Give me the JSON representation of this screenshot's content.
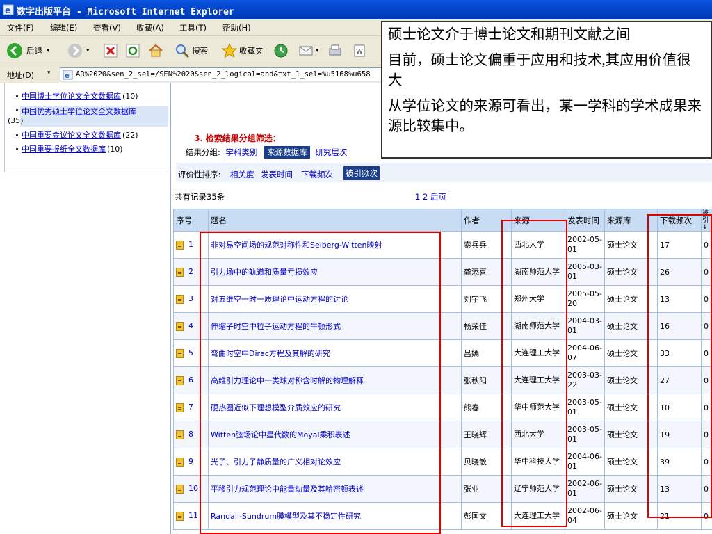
{
  "window": {
    "title": "数字出版平台 - Microsoft Internet Explorer"
  },
  "menu": [
    "文件(F)",
    "编辑(E)",
    "查看(V)",
    "收藏(A)",
    "工具(T)",
    "帮助(H)"
  ],
  "toolbar": {
    "back_label": "后退",
    "search_label": "搜索",
    "favorites_label": "收藏夹"
  },
  "address": {
    "label": "地址(D)",
    "url": "AR%2020&sen_2_sel=/SEN%2020&sen_2_logical=and&txt_1_sel=%u5168%u658"
  },
  "left_nav": {
    "items": [
      {
        "label": "中国博士学位论文全文数据库",
        "count": "(10)"
      },
      {
        "label": "中国优秀硕士学位论文全文数据库",
        "count": "(35)"
      },
      {
        "label": "中国重要会议论文全文数据库",
        "count": "(22)"
      },
      {
        "label": "中国重要报纸全文数据库",
        "count": "(10)"
      }
    ]
  },
  "filter": {
    "step_title": "3. 检索结果分组筛选：",
    "group_label": "结果分组:",
    "group_options": [
      "学科类别",
      "来源数据库",
      "研究层次"
    ],
    "group_selected": "来源数据库"
  },
  "sort": {
    "label": "评价性排序:",
    "options": [
      "相关度",
      "发表时间",
      "下载频次",
      "被引频次"
    ],
    "selected": "被引频次"
  },
  "results": {
    "count_text": "共有记录35条",
    "pager": "1 2 后页",
    "headers": [
      "序号",
      "题名",
      "作者",
      "来源",
      "发表时间",
      "来源库",
      "下载频次",
      "被引↓"
    ],
    "rows": [
      {
        "no": "1",
        "title": "非对易空间场的规范对称性和Seiberg-Witten映射",
        "author": "索兵兵",
        "source": "西北大学",
        "date": "2002-05-01",
        "db": "硕士论文",
        "downloads": "17",
        "cited": "0"
      },
      {
        "no": "2",
        "title": "引力场中的轨道和质量亏损效应",
        "author": "龚添喜",
        "source": "湖南师范大学",
        "date": "2005-03-01",
        "db": "硕士论文",
        "downloads": "26",
        "cited": "0"
      },
      {
        "no": "3",
        "title": "对五维空一时一质理论中运动方程的讨论",
        "author": "刘宇飞",
        "source": "郑州大学",
        "date": "2005-05-20",
        "db": "硕士论文",
        "downloads": "13",
        "cited": "0"
      },
      {
        "no": "4",
        "title": "伸缩子时空中粒子运动方程的牛顿形式",
        "author": "杨荣佳",
        "source": "湖南师范大学",
        "date": "2004-03-01",
        "db": "硕士论文",
        "downloads": "16",
        "cited": "0"
      },
      {
        "no": "5",
        "title": "弯曲时空中Dirac方程及其解的研究",
        "author": "吕嫣",
        "source": "大连理工大学",
        "date": "2004-06-07",
        "db": "硕士论文",
        "downloads": "33",
        "cited": "0"
      },
      {
        "no": "6",
        "title": "高维引力理论中一类球对称含时解的物理解释",
        "author": "张秋阳",
        "source": "大连理工大学",
        "date": "2003-03-22",
        "db": "硕士论文",
        "downloads": "27",
        "cited": "0"
      },
      {
        "no": "7",
        "title": "硬热圈近似下理想模型介质效应的研究",
        "author": "熊春",
        "source": "华中师范大学",
        "date": "2003-05-01",
        "db": "硕士论文",
        "downloads": "10",
        "cited": "0"
      },
      {
        "no": "8",
        "title": "Witten弦场论中星代数的Moyal乘积表述",
        "author": "王晓辉",
        "source": "西北大学",
        "date": "2003-05-01",
        "db": "硕士论文",
        "downloads": "19",
        "cited": "0"
      },
      {
        "no": "9",
        "title": "光子、引力子静质量的广义相对论效应",
        "author": "贝晓敏",
        "source": "华中科技大学",
        "date": "2004-06-01",
        "db": "硕士论文",
        "downloads": "39",
        "cited": "0"
      },
      {
        "no": "10",
        "title": "平移引力规范理论中能量动量及其哈密顿表述",
        "author": "张业",
        "source": "辽宁师范大学",
        "date": "2002-06-01",
        "db": "硕士论文",
        "downloads": "13",
        "cited": "0"
      },
      {
        "no": "11",
        "title": "Randall-Sundrum膜模型及其不稳定性研究",
        "author": "彭国文",
        "source": "大连理工大学",
        "date": "2002-06-04",
        "db": "硕士论文",
        "downloads": "21",
        "cited": "0"
      }
    ]
  },
  "callout": {
    "lines": [
      "硕士论文介于博士论文和期刊文献之间",
      "目前，硕士论文偏重于应用和技术,其应用价值很大",
      "从学位论文的来源可看出，某一学科的学术成果来源比较集中。"
    ]
  },
  "colors": {
    "titlebar": "#0242c8",
    "highlight": "#1a3e8a",
    "annotation_red": "#e00000",
    "link": "#0000cc"
  }
}
